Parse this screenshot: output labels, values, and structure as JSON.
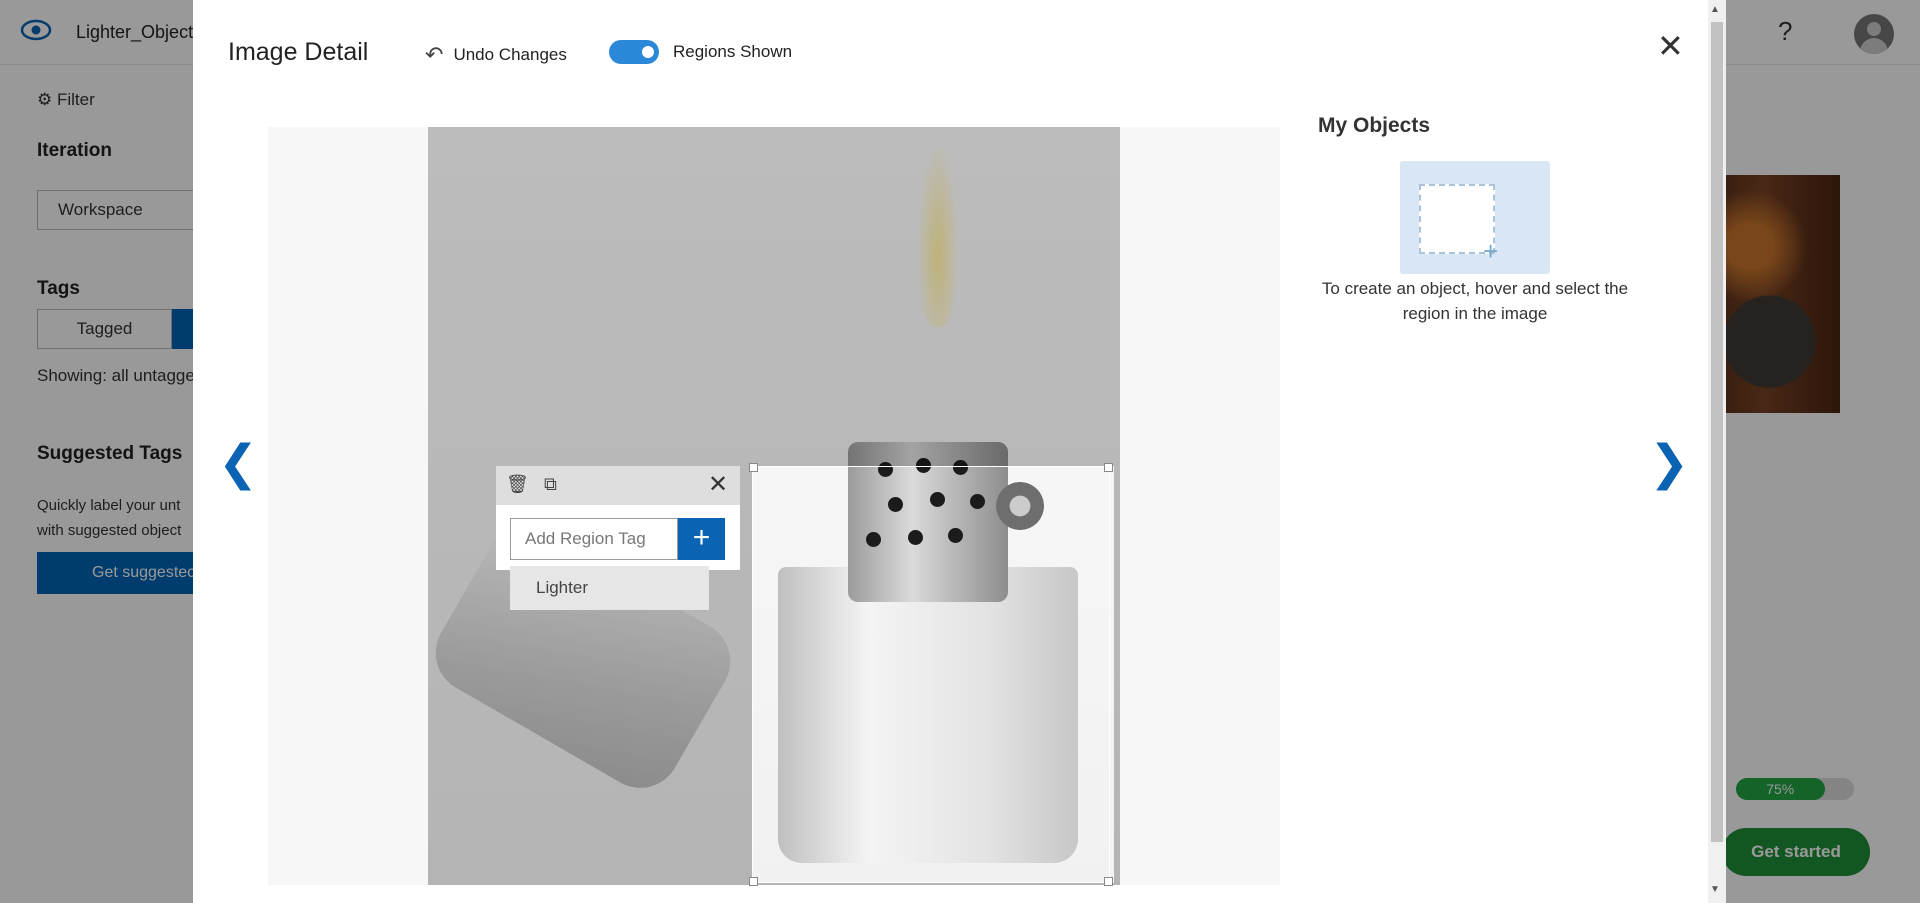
{
  "app": {
    "project_name": "Lighter_Object",
    "filter_label": "Filter",
    "iteration_label": "Iteration",
    "iteration_value": "Workspace",
    "tags_label": "Tags",
    "tagged_label": "Tagged",
    "showing_text": "Showing: all untagge",
    "suggested_tags_title": "Suggested Tags",
    "suggested_desc_line1": "Quickly label your unt",
    "suggested_desc_line2": "with suggested object",
    "get_suggested_label": "Get suggestec",
    "help_glyph": "?",
    "progress_text": "75%",
    "progress_fraction": 0.75,
    "get_started_label": "Get started"
  },
  "modal": {
    "title": "Image Detail",
    "undo_label": "Undo Changes",
    "regions_label": "Regions Shown",
    "regions_shown": true,
    "close_glyph": "✕",
    "prev_glyph": "❮",
    "next_glyph": "❯"
  },
  "tag_popup": {
    "input_placeholder": "Add Region Tag",
    "add_glyph": "+",
    "close_glyph": "✕",
    "suggestion": "Lighter"
  },
  "objects_panel": {
    "title": "My Objects",
    "help_text": "To create an object, hover and select the region in the image"
  },
  "icons": {
    "logo": "eye-icon",
    "filter": "filter-icon",
    "undo": "undo-icon",
    "delete": "trash-icon",
    "compare": "compare-icon"
  },
  "colors": {
    "accent": "#0a63b3",
    "toggle_on": "#2b88d8",
    "success": "#22a543",
    "object_card": "#d8e7f3"
  }
}
